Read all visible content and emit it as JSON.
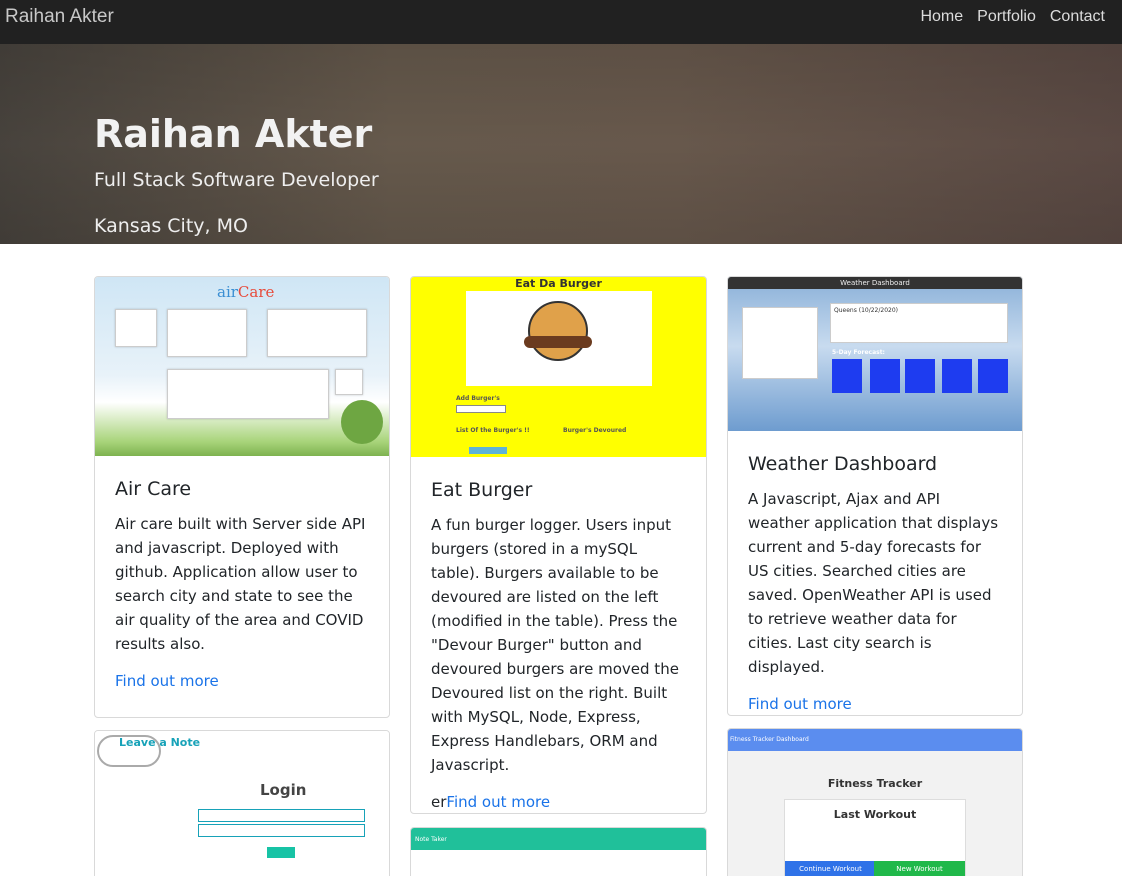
{
  "navbar": {
    "brand": "Raihan Akter",
    "links": [
      "Home",
      "Portfolio",
      "Contact"
    ]
  },
  "hero": {
    "name": "Raihan Akter",
    "subtitle": "Full Stack Software Developer",
    "location": "Kansas City, MO"
  },
  "cards": [
    {
      "title": "Air Care",
      "text": "Air care built with Server side API and javascript. Deployed with github. Application allow user to search city and state to see the air quality of the area and COVID results also.",
      "link_prefix": "",
      "link": "Find out more",
      "image_label": "airCare"
    },
    {
      "title": "Eat Burger",
      "text": "A fun burger logger. Users input burgers (stored in a mySQL table). Burgers available to be devoured are listed on the left (modified in the table). Press the \"Devour Burger\" button and devoured burgers are moved the Devoured list on the right. Built with MySQL, Node, Express, Express Handlebars, ORM and Javascript.",
      "link_prefix": "er",
      "link": "Find out more",
      "image_title": "Eat Da Burger",
      "image_labels": [
        "Add Burger's",
        "List Of the Burger's !!",
        "Burger's Devoured"
      ]
    },
    {
      "title": "Weather Dashboard",
      "text": "A Javascript, Ajax and API weather application that displays current and 5-day forecasts for US cities. Searched cities are saved. OpenWeather API is used to retrieve weather data for cities. Last city search is displayed.",
      "link_prefix": "",
      "link": "Find out more",
      "image_title": "Weather Dashboard",
      "image_city": "Queens (10/22/2020)",
      "image_forecast": "5-Day Forecast:"
    },
    {
      "image_logo": "Leave a Note",
      "image_heading": "Login"
    },
    {
      "image_bar": "Fitness Tracker Dashboard",
      "image_title": "Fitness Tracker",
      "image_heading": "Last Workout",
      "buttons": [
        "Continue Workout",
        "New Workout"
      ]
    },
    {
      "image_bar": "Note Taker"
    }
  ]
}
